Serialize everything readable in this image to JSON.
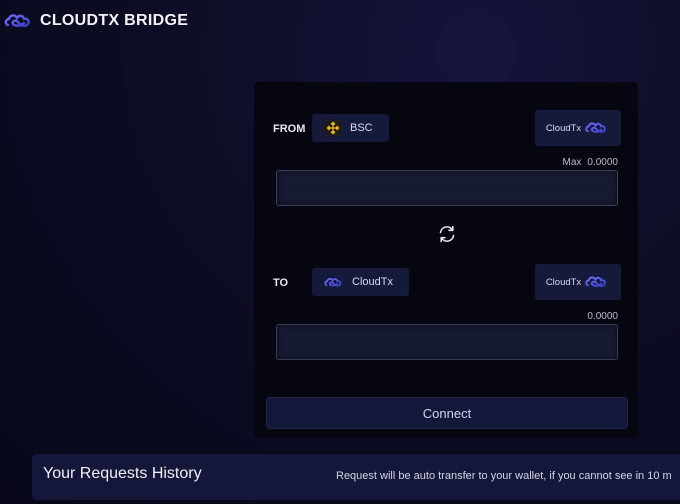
{
  "brand": {
    "name": "CLOUDTX BRIDGE",
    "logo_icon": "cloudtx-logo-icon"
  },
  "from": {
    "label": "FROM",
    "chain": {
      "name": "BSC",
      "icon": "bnb-icon"
    },
    "token": {
      "name": "CloudTx",
      "icon": "cloudtx-logo-icon"
    },
    "max_label": "Max",
    "balance": "0.0000",
    "input_value": ""
  },
  "swap_icon": "swap-refresh-icon",
  "to": {
    "label": "TO",
    "chain": {
      "name": "CloudTx",
      "icon": "cloudtx-logo-icon"
    },
    "token": {
      "name": "CloudTx",
      "icon": "cloudtx-logo-icon"
    },
    "balance": "0.0000",
    "input_value": ""
  },
  "connect_label": "Connect",
  "history": {
    "title": "Your Requests History",
    "note": "Request will be auto transfer to your wallet, if you cannot see in 10 m"
  },
  "colors": {
    "background": "#0b0b22",
    "panel": "#060610",
    "pill": "#161a3a",
    "accent": "#4b4fd8",
    "bnb": "#f0b90b"
  }
}
